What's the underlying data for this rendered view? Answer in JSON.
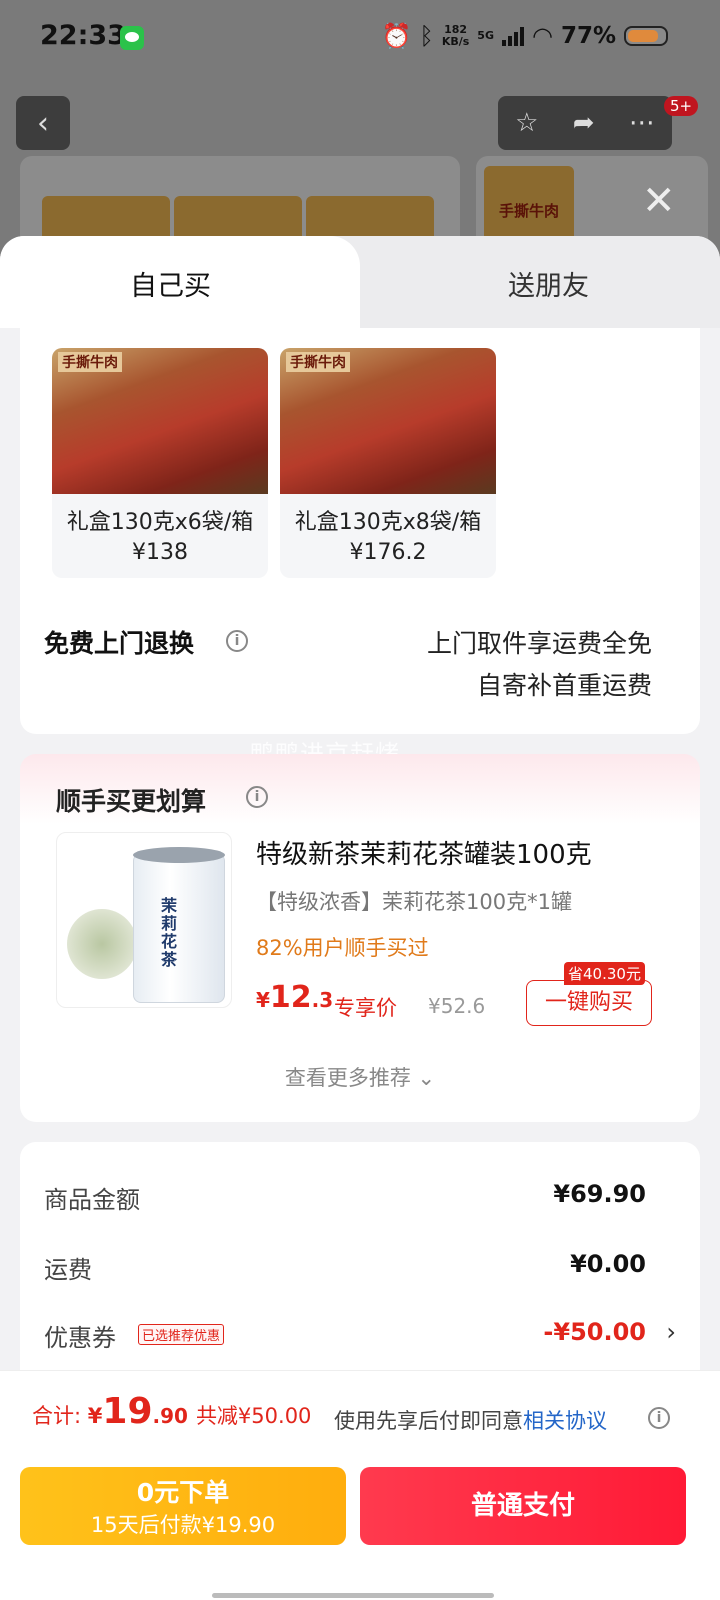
{
  "status_bar": {
    "time": "22:33",
    "net_speed_value": "182",
    "net_speed_unit": "KB/s",
    "network_type": "5G",
    "battery": "77%"
  },
  "header": {
    "badge": "5+",
    "back_icon": "chevron-left-icon",
    "icons": [
      "star-icon",
      "share-icon",
      "more-icon"
    ]
  },
  "background": {
    "product_label": "手撕牛肉"
  },
  "tabs": {
    "self": "自己买",
    "gift": "送朋友"
  },
  "skus": [
    {
      "image_label": "手撕牛肉",
      "text": "礼盒130克x6袋/箱 ¥138"
    },
    {
      "image_label": "手撕牛肉",
      "text": "礼盒130克x8袋/箱 ¥176.2"
    }
  ],
  "return_service": {
    "title": "免费上门退换",
    "line1": "上门取件享运费全免",
    "line2": "自寄补首重运费"
  },
  "watermark": "鸭鸭进京赶烤",
  "recommendation": {
    "title": "顺手买更划算",
    "product_name": "特级新茶茉莉花茶罐装100克",
    "product_desc": "【特级浓香】茉莉花茶100克*1罐",
    "social_proof": "82%用户顺手买过",
    "price_currency": "¥",
    "price_int": "12",
    "price_dec": ".3",
    "price_tag": "专享价",
    "original_price": "¥52.6",
    "save_badge": "省40.30元",
    "buy_button": "一键购买",
    "can_label": "茉莉花茶",
    "more": "查看更多推荐 ⌄"
  },
  "summary": {
    "goods_label": "商品金额",
    "goods_value": "¥69.90",
    "shipping_label": "运费",
    "shipping_value": "¥0.00",
    "coupon_label": "优惠券",
    "coupon_tag": "已选推荐优惠",
    "coupon_value": "-¥50.00"
  },
  "bottom_bar": {
    "total_label": "合计: ",
    "total_currency": "¥",
    "total_int": "19",
    "total_dec": ".90",
    "total_reduce": "共减¥50.00",
    "agree_text": "使用先享后付即同意",
    "agree_link": "相关协议",
    "later_line1": "0元下单",
    "later_line2": "15天后付款¥19.90",
    "pay_button": "普通支付"
  },
  "colors": {
    "accent_red": "#e1251b",
    "pay_red": "#ff1a36",
    "later_yellow": "#ffad0d",
    "link_blue": "#2466c8",
    "orange": "#e07a1a"
  }
}
